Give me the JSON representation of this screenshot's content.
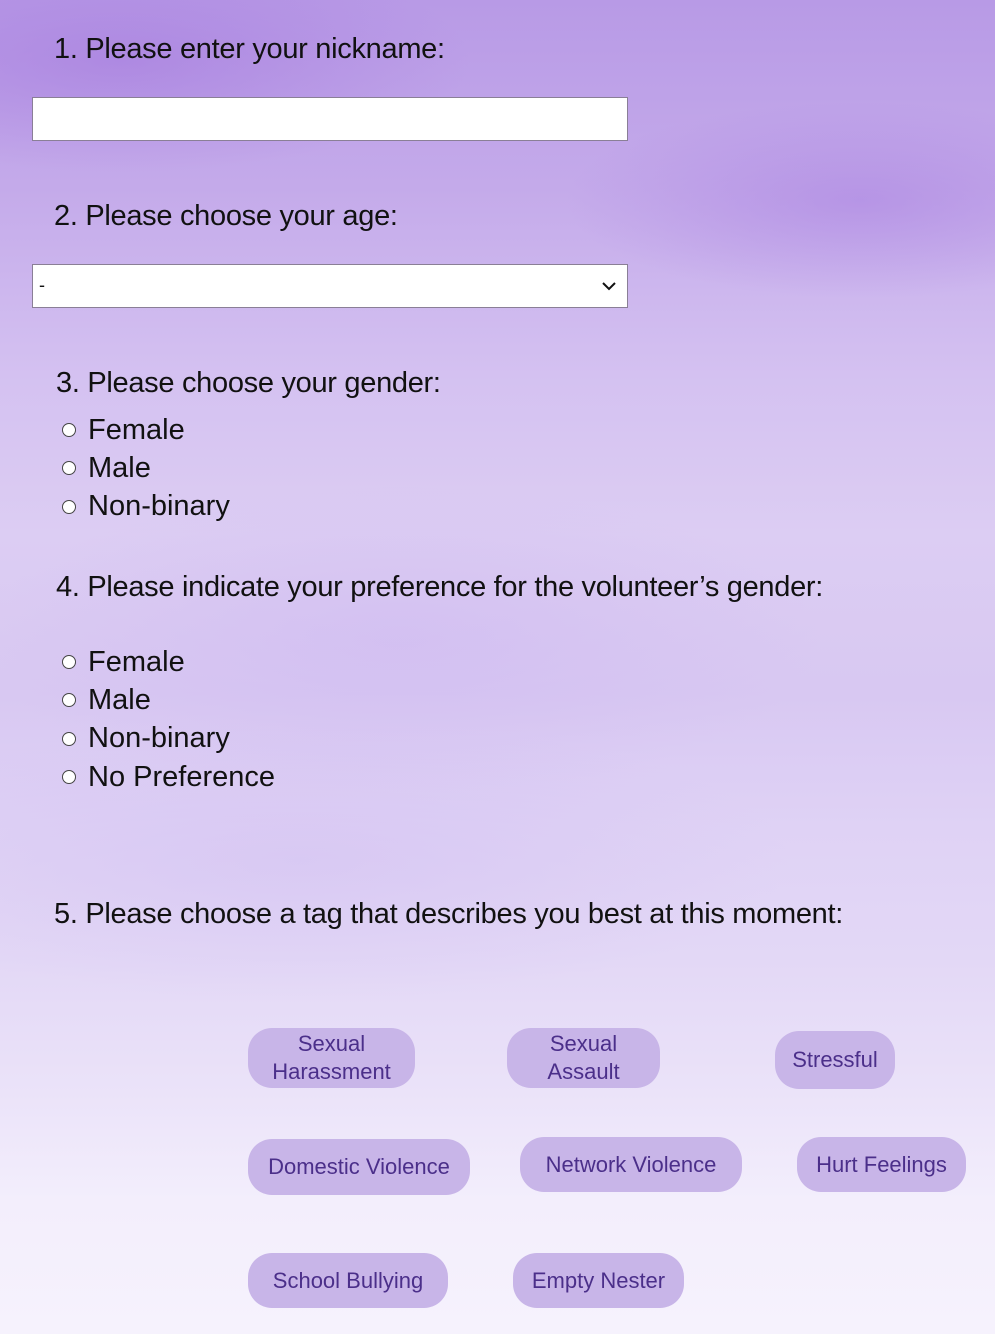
{
  "form": {
    "q1": {
      "title": "1. Please enter your nickname:",
      "value": ""
    },
    "q2": {
      "title": "2. Please choose your age:",
      "selected": "-"
    },
    "q3": {
      "title": "3. Please choose your gender:",
      "options": [
        "Female",
        "Male",
        "Non-binary"
      ]
    },
    "q4": {
      "title": "4. Please indicate your preference for the volunteer’s gender:",
      "options": [
        "Female",
        "Male",
        "Non-binary",
        "No Preference"
      ]
    },
    "q5": {
      "title": "5. Please choose a tag that describes you best at this moment:",
      "tags": [
        "Sexual Harassment",
        "Sexual Assault",
        "Stressful",
        "Domestic Violence",
        "Network Violence",
        "Hurt Feelings",
        "School Bullying",
        "Empty Nester"
      ]
    }
  },
  "icons": {
    "select_arrow": "chevron-down-icon"
  },
  "colors": {
    "tag_background": "#c8b5e8",
    "tag_text": "#4b2f8a",
    "page_top": "#b89ae6",
    "page_bottom": "#f6f2fd"
  }
}
